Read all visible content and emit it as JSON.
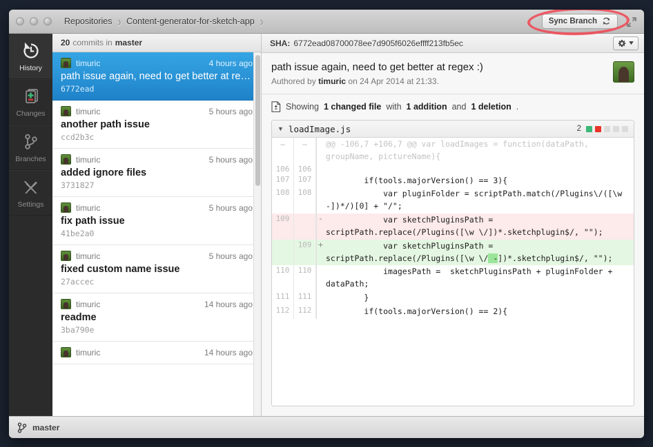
{
  "window": {
    "traffic_lights": [
      "close",
      "minimize",
      "zoom"
    ],
    "breadcrumbs": [
      "Repositories",
      "Content-generator-for-sketch-app"
    ],
    "sync_branch_label": "Sync Branch",
    "annotation": "red-ellipse-highlight"
  },
  "sidebar": {
    "items": [
      {
        "label": "History",
        "icon": "history-icon",
        "active": true
      },
      {
        "label": "Changes",
        "icon": "changes-icon",
        "active": false
      },
      {
        "label": "Branches",
        "icon": "branches-icon",
        "active": false
      },
      {
        "label": "Settings",
        "icon": "settings-icon",
        "active": false
      }
    ]
  },
  "commit_list": {
    "count": "20",
    "count_suffix": "commits in",
    "branch": "master",
    "commits": [
      {
        "author": "timuric",
        "time": "4 hours ago",
        "title": "path issue again, need to get better at re…",
        "sha": "6772ead",
        "selected": true
      },
      {
        "author": "timuric",
        "time": "5 hours ago",
        "title": "another path issue",
        "sha": "ccd2b3c",
        "selected": false
      },
      {
        "author": "timuric",
        "time": "5 hours ago",
        "title": "added ignore files",
        "sha": "3731827",
        "selected": false
      },
      {
        "author": "timuric",
        "time": "5 hours ago",
        "title": "fix path issue",
        "sha": "41be2a0",
        "selected": false
      },
      {
        "author": "timuric",
        "time": "5 hours ago",
        "title": "fixed custom name issue",
        "sha": "27accec",
        "selected": false
      },
      {
        "author": "timuric",
        "time": "14 hours ago",
        "title": "readme",
        "sha": "3ba790e",
        "selected": false
      },
      {
        "author": "timuric",
        "time": "14 hours ago",
        "title": "",
        "sha": "",
        "selected": false
      }
    ]
  },
  "detail": {
    "sha_label": "SHA:",
    "sha_value": "6772ead08700078ee7d905f6026effff213fb5ec",
    "gear_icon": "gear-icon",
    "title": "path issue again, need to get better at regex :)",
    "authored_prefix": "Authored by",
    "author": "timuric",
    "authored_suffix": "on 24 Apr 2014 at 21:33.",
    "summary": {
      "icon": "changed-file-icon",
      "prefix": "Showing",
      "files": "1 changed file",
      "mid": "with",
      "additions": "1 addition",
      "and": "and",
      "deletions": "1 deletion",
      "period": "."
    }
  },
  "diff": {
    "filename": "loadImage.js",
    "disclosure": "▼",
    "stat_count": "2",
    "stat_squares": [
      "#3cb878",
      "#e8342a",
      "#dcdcdc",
      "#dcdcdc",
      "#dcdcdc"
    ],
    "lines": [
      {
        "type": "hunk",
        "old": "…",
        "new": "…",
        "marker": "",
        "code": "@@ -106,7 +106,7 @@ var loadImages = function(dataPath, groupName, pictureName){"
      },
      {
        "type": "ctx",
        "old": "106",
        "new": "106",
        "marker": "",
        "code": ""
      },
      {
        "type": "ctx",
        "old": "107",
        "new": "107",
        "marker": "",
        "code": "        if(tools.majorVersion() == 3){"
      },
      {
        "type": "ctx",
        "old": "108",
        "new": "108",
        "marker": "",
        "code": "            var pluginFolder = scriptPath.match(/Plugins\\/([\\w -])*/)[0] + \"/\";"
      },
      {
        "type": "del",
        "old": "109",
        "new": "",
        "marker": "-",
        "code_pre": "            var sketchPluginsPath = scriptPath.replace(/Plugins([\\w \\/])*.sketchplugin$/, \"\");"
      },
      {
        "type": "add",
        "old": "",
        "new": "109",
        "marker": "+",
        "code_a": "            var sketchPluginsPath = scriptPath.replace(/Plugins([\\w \\/",
        "code_hl": " -",
        "code_b": "])*.sketchplugin$/, \"\");"
      },
      {
        "type": "ctx",
        "old": "110",
        "new": "110",
        "marker": "",
        "code": "            imagesPath =  sketchPluginsPath + pluginFolder + dataPath;"
      },
      {
        "type": "ctx",
        "old": "111",
        "new": "111",
        "marker": "",
        "code": "        }"
      },
      {
        "type": "ctx",
        "old": "112",
        "new": "112",
        "marker": "",
        "code": "        if(tools.majorVersion() == 2){"
      }
    ]
  },
  "statusbar": {
    "branch_icon": "branch-icon",
    "branch": "master"
  }
}
